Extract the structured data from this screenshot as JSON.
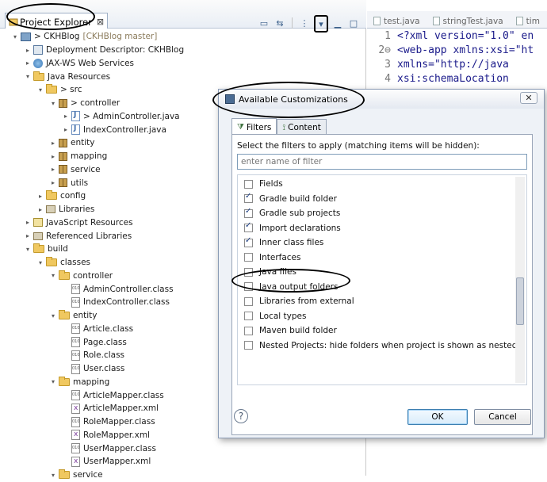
{
  "explorer": {
    "tab_label": "Project Explorer",
    "tab_close": "⊠",
    "toolbar": [
      "▭",
      "⇆",
      "⋮",
      "▾",
      "▁",
      "□"
    ]
  },
  "tree": [
    {
      "indent": 0,
      "tw": "▾",
      "icon": "proj",
      "label": "> CKHBlog",
      "extra": "[CKHBlog master]"
    },
    {
      "indent": 1,
      "tw": "▸",
      "icon": "dd",
      "label": "Deployment Descriptor: CKHBlog"
    },
    {
      "indent": 1,
      "tw": "▸",
      "icon": "web",
      "label": "JAX-WS Web Services"
    },
    {
      "indent": 1,
      "tw": "▾",
      "icon": "folder",
      "label": "Java Resources"
    },
    {
      "indent": 2,
      "tw": "▾",
      "icon": "folder",
      "label": "> src"
    },
    {
      "indent": 3,
      "tw": "▾",
      "icon": "pkg",
      "label": "> controller"
    },
    {
      "indent": 4,
      "tw": "▸",
      "icon": "jfile",
      "label": "> AdminController.java"
    },
    {
      "indent": 4,
      "tw": "▸",
      "icon": "jfile",
      "label": "IndexController.java"
    },
    {
      "indent": 3,
      "tw": "▸",
      "icon": "pkg",
      "label": "entity"
    },
    {
      "indent": 3,
      "tw": "▸",
      "icon": "pkg",
      "label": "mapping"
    },
    {
      "indent": 3,
      "tw": "▸",
      "icon": "pkg",
      "label": "service"
    },
    {
      "indent": 3,
      "tw": "▸",
      "icon": "pkg",
      "label": "utils"
    },
    {
      "indent": 2,
      "tw": "▸",
      "icon": "folder",
      "label": "config"
    },
    {
      "indent": 2,
      "tw": "▸",
      "icon": "lib",
      "label": "Libraries"
    },
    {
      "indent": 1,
      "tw": "▸",
      "icon": "js",
      "label": "JavaScript Resources"
    },
    {
      "indent": 1,
      "tw": "▸",
      "icon": "lib",
      "label": "Referenced Libraries"
    },
    {
      "indent": 1,
      "tw": "▾",
      "icon": "folder",
      "label": "build"
    },
    {
      "indent": 2,
      "tw": "▾",
      "icon": "folder",
      "label": "classes"
    },
    {
      "indent": 3,
      "tw": "▾",
      "icon": "folder",
      "label": "controller"
    },
    {
      "indent": 4,
      "tw": "",
      "icon": "cfile",
      "label": "AdminController.class"
    },
    {
      "indent": 4,
      "tw": "",
      "icon": "cfile",
      "label": "IndexController.class"
    },
    {
      "indent": 3,
      "tw": "▾",
      "icon": "folder",
      "label": "entity"
    },
    {
      "indent": 4,
      "tw": "",
      "icon": "cfile",
      "label": "Article.class"
    },
    {
      "indent": 4,
      "tw": "",
      "icon": "cfile",
      "label": "Page.class"
    },
    {
      "indent": 4,
      "tw": "",
      "icon": "cfile",
      "label": "Role.class"
    },
    {
      "indent": 4,
      "tw": "",
      "icon": "cfile",
      "label": "User.class"
    },
    {
      "indent": 3,
      "tw": "▾",
      "icon": "folder",
      "label": "mapping"
    },
    {
      "indent": 4,
      "tw": "",
      "icon": "cfile",
      "label": "ArticleMapper.class"
    },
    {
      "indent": 4,
      "tw": "",
      "icon": "xfile",
      "label": "ArticleMapper.xml"
    },
    {
      "indent": 4,
      "tw": "",
      "icon": "cfile",
      "label": "RoleMapper.class"
    },
    {
      "indent": 4,
      "tw": "",
      "icon": "xfile",
      "label": "RoleMapper.xml"
    },
    {
      "indent": 4,
      "tw": "",
      "icon": "cfile",
      "label": "UserMapper.class"
    },
    {
      "indent": 4,
      "tw": "",
      "icon": "xfile",
      "label": "UserMapper.xml"
    },
    {
      "indent": 3,
      "tw": "▾",
      "icon": "folder",
      "label": "service"
    }
  ],
  "editor": {
    "tabs": [
      "test.java",
      "stringTest.java",
      "tim"
    ],
    "lines": [
      {
        "n": "1",
        "text": "<?xml version=\"1.0\" en"
      },
      {
        "n": "2⊖",
        "text": "<web-app xmlns:xsi=\"ht"
      },
      {
        "n": "3",
        "text": "    xmlns=\"http://java"
      },
      {
        "n": "4",
        "text": "    xsi:schemaLocation"
      }
    ]
  },
  "dialog": {
    "title": "Available Customizations",
    "close": "✕",
    "tabs": [
      "Filters",
      "Content"
    ],
    "instruction": "Select the filters to apply (matching items will be hidden):",
    "filter_placeholder": "enter name of filter",
    "items": [
      {
        "label": "Fields",
        "checked": false
      },
      {
        "label": "Gradle build folder",
        "checked": true
      },
      {
        "label": "Gradle sub projects",
        "checked": true
      },
      {
        "label": "Import declarations",
        "checked": true
      },
      {
        "label": "Inner class files",
        "checked": true
      },
      {
        "label": "Interfaces",
        "checked": false
      },
      {
        "label": "Java files",
        "checked": false
      },
      {
        "label": "Java output folders",
        "checked": false
      },
      {
        "label": "Libraries from external",
        "checked": false
      },
      {
        "label": "Local types",
        "checked": false
      },
      {
        "label": "Maven build folder",
        "checked": false
      },
      {
        "label": "Nested Projects: hide folders when project is shown as nested",
        "checked": false
      }
    ],
    "help": "?",
    "ok_label": "OK",
    "cancel_label": "Cancel"
  }
}
